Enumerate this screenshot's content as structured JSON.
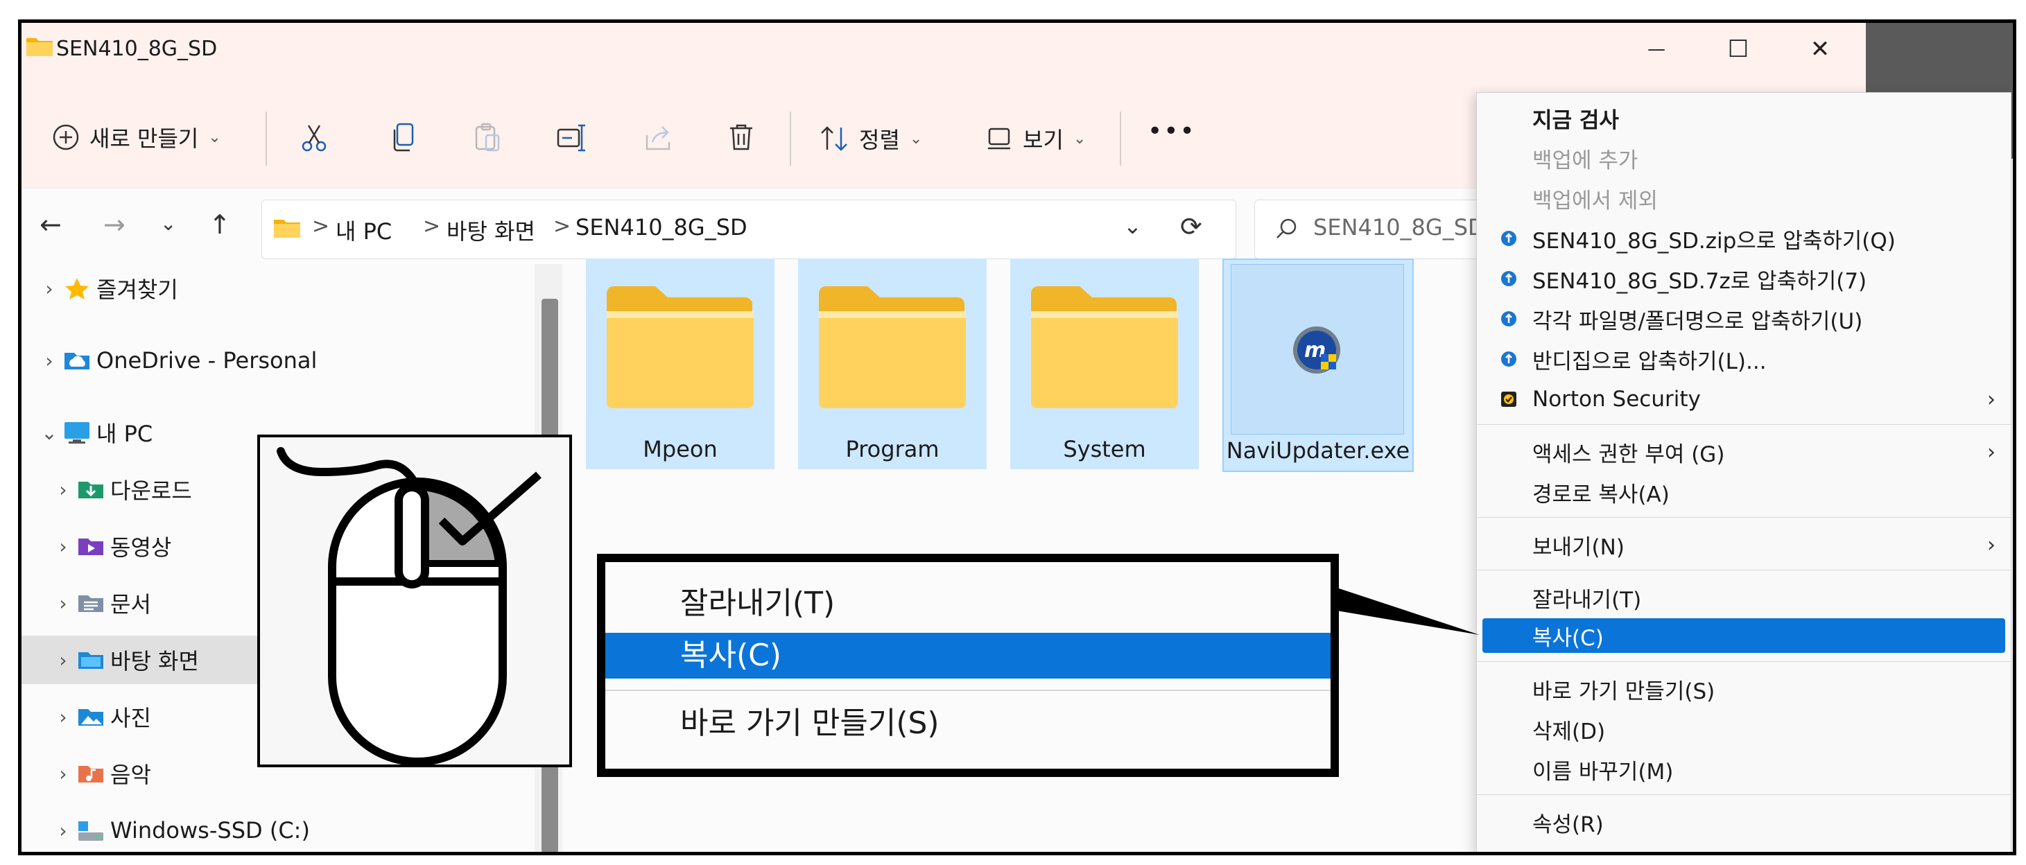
{
  "window": {
    "title": "SEN410_8G_SD",
    "minimize_glyph": "—",
    "maximize_glyph": "☐",
    "close_glyph": "✕"
  },
  "toolbar": {
    "new_label": "새로 만들기",
    "sort_label": "정렬",
    "view_label": "보기",
    "more_glyph": "•••",
    "icons": [
      "plus-circle-icon",
      "cut-icon",
      "copy-icon",
      "paste-icon",
      "rename-icon",
      "share-icon",
      "delete-icon",
      "sort-icon",
      "view-icon",
      "more-icon"
    ]
  },
  "address": {
    "crumbs": [
      "내 PC",
      "바탕 화면",
      "SEN410_8G_SD"
    ],
    "separator": ">",
    "search_placeholder": "SEN410_8G_SD"
  },
  "sidebar": {
    "items": [
      {
        "label": "즐겨찾기",
        "icon": "star-icon",
        "expanded": false
      },
      {
        "label": "OneDrive - Personal",
        "icon": "cloud-icon",
        "expanded": false
      },
      {
        "label": "내 PC",
        "icon": "monitor-icon",
        "expanded": true
      },
      {
        "label": "다운로드",
        "icon": "download-folder-icon",
        "expanded": false
      },
      {
        "label": "동영상",
        "icon": "video-folder-icon",
        "expanded": false
      },
      {
        "label": "문서",
        "icon": "document-folder-icon",
        "expanded": false
      },
      {
        "label": "바탕 화면",
        "icon": "desktop-folder-icon",
        "expanded": false,
        "selected": true
      },
      {
        "label": "사진",
        "icon": "pictures-folder-icon",
        "expanded": false
      },
      {
        "label": "음악",
        "icon": "music-folder-icon",
        "expanded": false
      },
      {
        "label": "Windows-SSD (C:)",
        "icon": "drive-icon",
        "expanded": false
      }
    ]
  },
  "files": [
    {
      "name": "Mpeon",
      "type": "folder"
    },
    {
      "name": "Program",
      "type": "folder"
    },
    {
      "name": "System",
      "type": "folder"
    },
    {
      "name": "NaviUpdater.exe",
      "type": "exe"
    }
  ],
  "zoom": {
    "items": [
      "잘라내기(T)",
      "복사(C)",
      "바로 가기 만들기(S)"
    ],
    "selected_index": 1
  },
  "context_menu": {
    "items": [
      {
        "label": "지금 검사",
        "style": "bold"
      },
      {
        "label": "백업에 추가",
        "style": "disabled"
      },
      {
        "label": "백업에서 제외",
        "style": "disabled"
      },
      {
        "label": "SEN410_8G_SD.zip으로 압축하기(Q)",
        "icon": "bandizip-icon"
      },
      {
        "label": "SEN410_8G_SD.7z로 압축하기(7)",
        "icon": "bandizip-icon"
      },
      {
        "label": "각각 파일명/폴더명으로 압축하기(U)",
        "icon": "bandizip-icon"
      },
      {
        "label": "반디집으로 압축하기(L)...",
        "icon": "bandizip-icon"
      },
      {
        "label": "Norton Security",
        "icon": "norton-icon",
        "submenu": true
      },
      {
        "label": "액세스 권한 부여 (G)",
        "submenu": true
      },
      {
        "label": "경로로 복사(A)"
      },
      {
        "label": "보내기(N)",
        "submenu": true
      },
      {
        "label": "잘라내기(T)"
      },
      {
        "label": "복사(C)",
        "selected": true
      },
      {
        "label": "바로 가기 만들기(S)"
      },
      {
        "label": "삭제(D)"
      },
      {
        "label": "이름 바꾸기(M)"
      },
      {
        "label": "속성(R)"
      }
    ],
    "submenu_glyph": "›"
  },
  "colors": {
    "selection_blue": "#0a74d8",
    "tile_highlight": "#cce8ff",
    "titlebar_bg": "#fef1ee",
    "folder_yellow": "#ffc83d"
  }
}
